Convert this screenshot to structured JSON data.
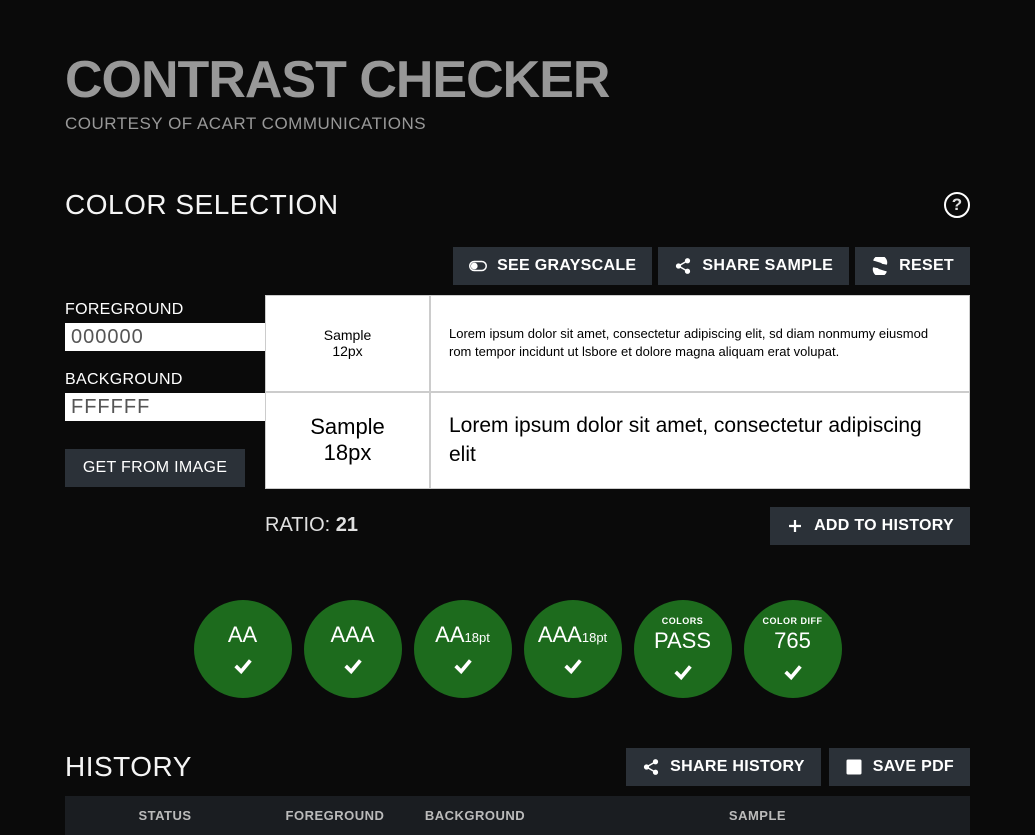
{
  "header": {
    "title": "CONTRAST CHECKER",
    "subtitle": "COURTESY OF ACART COMMUNICATIONS"
  },
  "colorSelection": {
    "heading": "COLOR SELECTION",
    "foregroundLabel": "FOREGROUND",
    "foregroundValue": "000000",
    "backgroundLabel": "BACKGROUND",
    "backgroundValue": "FFFFFF",
    "getFromImage": "GET FROM IMAGE"
  },
  "toolbar": {
    "grayscale": "SEE GRAYSCALE",
    "share": "SHARE SAMPLE",
    "reset": "RESET"
  },
  "samples": {
    "smallLabel1": "Sample",
    "smallLabel2": "12px",
    "bigLabel1": "Sample",
    "bigLabel2": "18px",
    "smallText": "Lorem ipsum dolor sit amet, consectetur adipiscing elit, sd diam nonmumy eiusmod rom tempor incidunt ut lsbore et dolore magna aliquam erat volupat.",
    "bigText": "Lorem ipsum dolor sit amet, consectetur adipiscing elit"
  },
  "ratio": {
    "label": "RATIO: ",
    "value": "21"
  },
  "addHistory": "ADD TO HISTORY",
  "badges": {
    "aa": "AA",
    "aaa": "AAA",
    "aa18": "AA",
    "aa18sm": "18pt",
    "aaa18": "AAA",
    "aaa18sm": "18pt",
    "colorsPre": "COLORS",
    "colorsMain": "PASS",
    "diffPre": "COLOR DIFF",
    "diffMain": "765"
  },
  "history": {
    "heading": "HISTORY",
    "shareHistory": "SHARE HISTORY",
    "savePdf": "SAVE PDF",
    "cols": {
      "status": "STATUS",
      "foreground": "FOREGROUND",
      "background": "BACKGROUND",
      "sample": "SAMPLE"
    }
  }
}
